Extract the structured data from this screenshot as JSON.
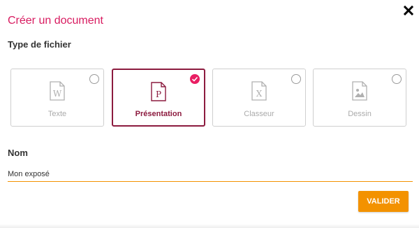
{
  "dialog": {
    "title": "Créer un document",
    "close_icon": "close-icon",
    "type_label": "Type de fichier",
    "file_types": [
      {
        "label": "Texte",
        "icon": "word-doc-icon",
        "letter": "W",
        "selected": false
      },
      {
        "label": "Présentation",
        "icon": "presentation-doc-icon",
        "letter": "P",
        "selected": true
      },
      {
        "label": "Classeur",
        "icon": "spreadsheet-doc-icon",
        "letter": "X",
        "selected": false
      },
      {
        "label": "Dessin",
        "icon": "drawing-doc-icon",
        "letter": "",
        "selected": false
      }
    ],
    "name_label": "Nom",
    "name_value": "Mon exposé",
    "submit_label": "VALIDER"
  },
  "colors": {
    "title": "#d81b60",
    "selected_border": "#8c1b3f",
    "selected_radio": "#e91e63",
    "accent": "#f39200",
    "inactive": "#aaaaaa"
  }
}
